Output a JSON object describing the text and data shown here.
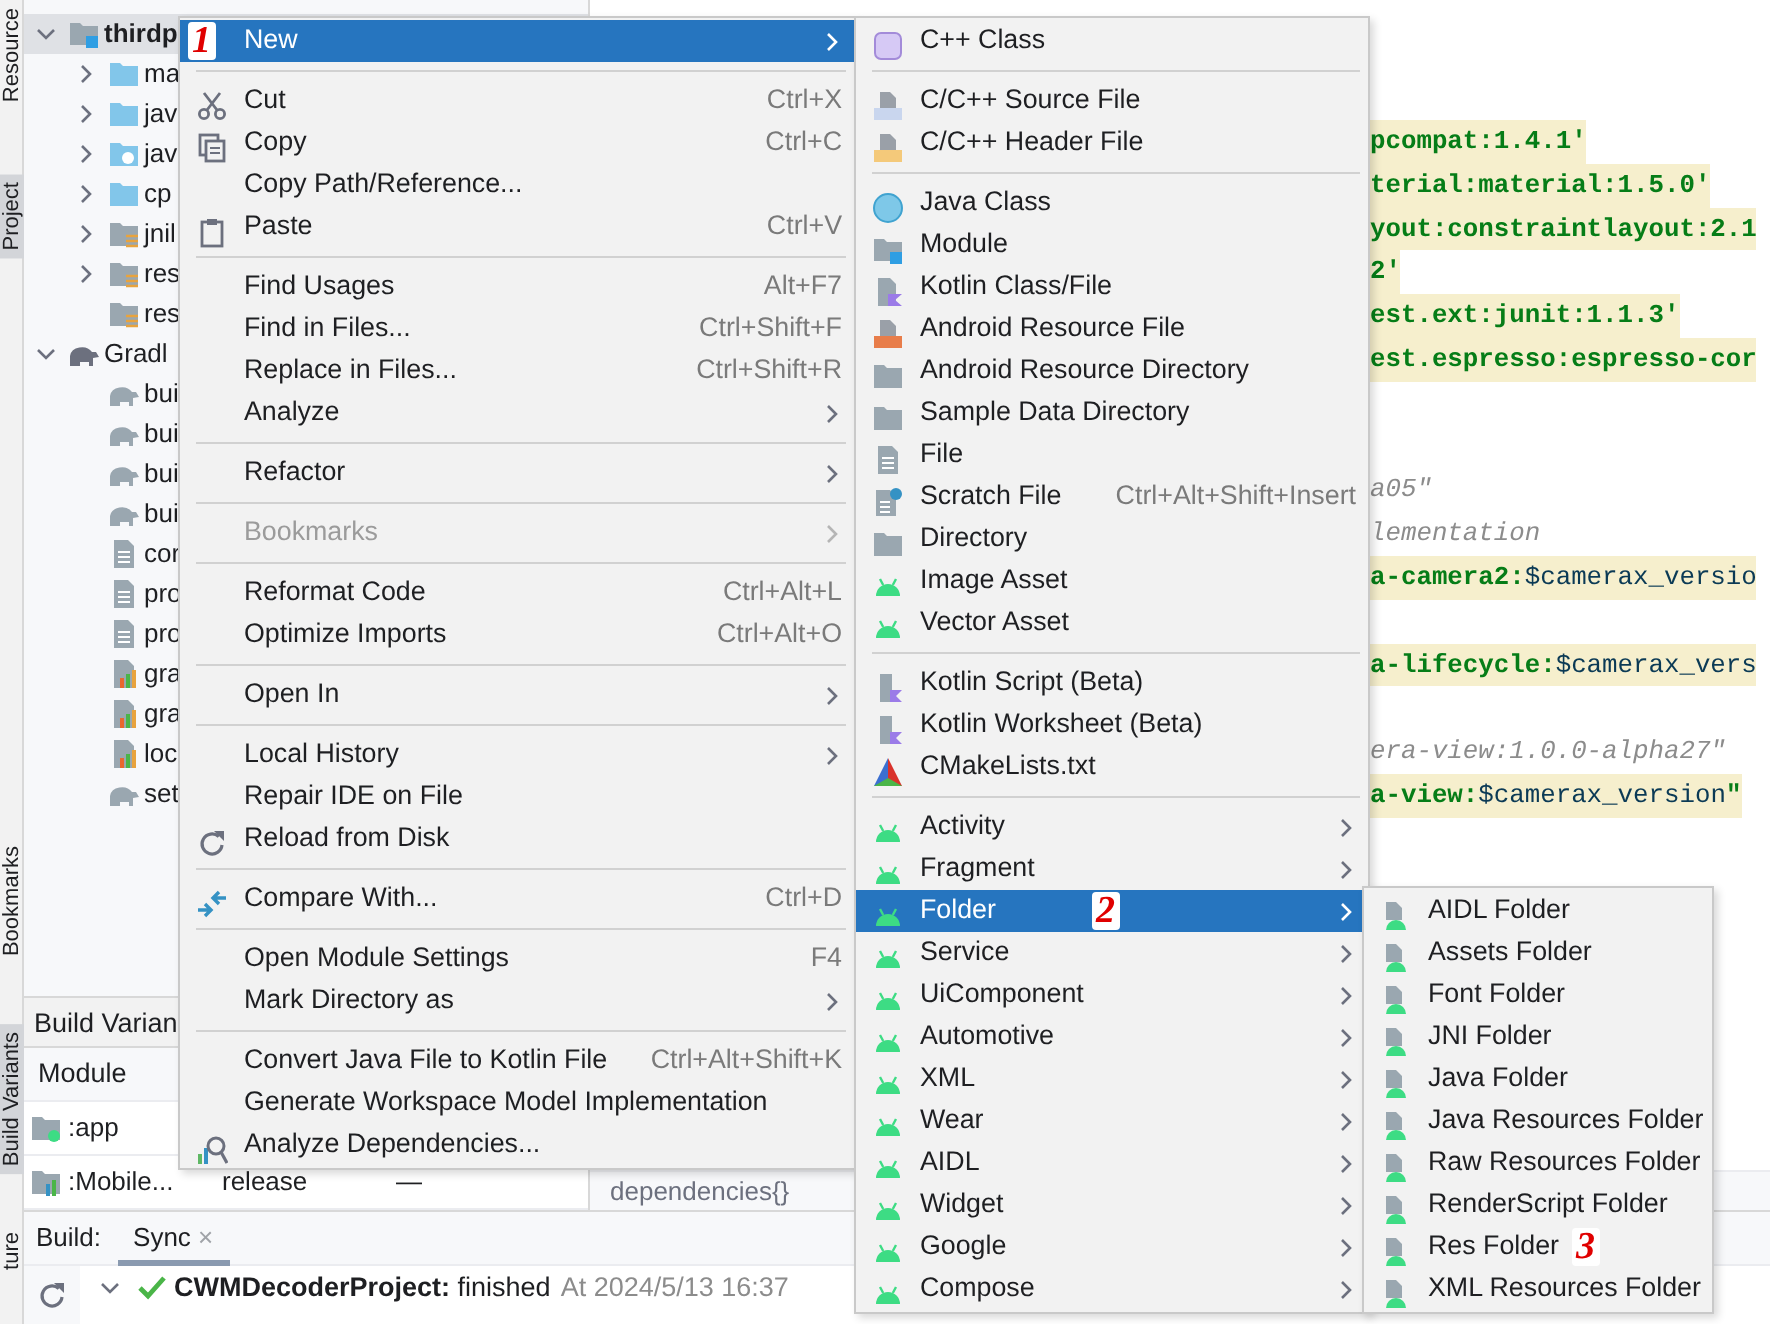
{
  "tool_strip": [
    {
      "label": "Resource",
      "selected": false
    },
    {
      "label": "Project",
      "selected": true
    },
    {
      "label": "Bookmarks",
      "selected": false
    },
    {
      "label": "Build Variants",
      "selected": true
    },
    {
      "label": "ture",
      "selected": false
    }
  ],
  "project_tree": [
    {
      "label": "thirdp",
      "kind": "module",
      "selected": true,
      "expanded": true,
      "children": [
        {
          "label": "ma",
          "kind": "bluefolder",
          "selected": false,
          "expanded": false
        },
        {
          "label": "jav",
          "kind": "bluefolder",
          "selected": false,
          "expanded": false
        },
        {
          "label": "jav",
          "kind": "gearfolder",
          "selected": false,
          "expanded": false
        },
        {
          "label": "cp",
          "kind": "bluefolder",
          "selected": false,
          "expanded": false
        },
        {
          "label": "jnil",
          "kind": "resfolder",
          "selected": false,
          "expanded": false
        },
        {
          "label": "res",
          "kind": "resfolder",
          "selected": false,
          "expanded": false
        },
        {
          "label": "res",
          "kind": "resfolder",
          "selected": false
        }
      ]
    },
    {
      "label": "Gradl",
      "kind": "gradle",
      "selected": false,
      "expanded": true,
      "children": [
        {
          "label": "bui",
          "kind": "gradlefile",
          "selected": false
        },
        {
          "label": "bui",
          "kind": "gradlefile",
          "selected": false
        },
        {
          "label": "bui",
          "kind": "gradlefile",
          "selected": false
        },
        {
          "label": "bui",
          "kind": "gradlefile",
          "selected": false
        },
        {
          "label": "cor",
          "kind": "file",
          "selected": false
        },
        {
          "label": "pro",
          "kind": "file",
          "selected": false
        },
        {
          "label": "pro",
          "kind": "file",
          "selected": false
        },
        {
          "label": "gra",
          "kind": "chartfile",
          "selected": false
        },
        {
          "label": "gra",
          "kind": "chartfile",
          "selected": false
        },
        {
          "label": "loc",
          "kind": "chartfile",
          "selected": false
        },
        {
          "label": "set",
          "kind": "gradlefile",
          "selected": false
        }
      ]
    }
  ],
  "build_variants": {
    "title": "Build Varian",
    "columns": [
      "Module"
    ],
    "rows": [
      {
        "module": ":app",
        "kind": "appfolder"
      },
      {
        "module": ":Mobile...",
        "kind": "chartfolder",
        "variant": "release",
        "column_3": "—"
      }
    ]
  },
  "editor": {
    "lines": [
      {
        "kind": "code",
        "segments": [
          {
            "kind": "string",
            "text": "pcompat:1.4.1'"
          }
        ]
      },
      {
        "kind": "code",
        "segments": [
          {
            "kind": "string",
            "text": "terial:material:1.5.0'"
          }
        ]
      },
      {
        "kind": "code",
        "segments": [
          {
            "kind": "string",
            "text": "yout:constraintlayout:2.1"
          }
        ]
      },
      {
        "kind": "code",
        "segments": [
          {
            "kind": "string",
            "text": "2'"
          }
        ]
      },
      {
        "kind": "code",
        "segments": [
          {
            "kind": "string",
            "text": "est.ext:junit:1.1.3'"
          }
        ]
      },
      {
        "kind": "code",
        "segments": [
          {
            "kind": "string",
            "text": "est.espresso:espresso-cor"
          }
        ]
      },
      {
        "kind": "blank"
      },
      {
        "kind": "blank"
      },
      {
        "kind": "comment",
        "segments": [
          {
            "kind": "comment",
            "text": "a05\""
          }
        ]
      },
      {
        "kind": "comment",
        "segments": [
          {
            "kind": "comment",
            "text": "lementation"
          }
        ]
      },
      {
        "kind": "code",
        "segments": [
          {
            "kind": "string",
            "text": "a-camera2:"
          },
          {
            "kind": "template",
            "text": "$camerax_versio"
          }
        ]
      },
      {
        "kind": "blank"
      },
      {
        "kind": "code",
        "segments": [
          {
            "kind": "string",
            "text": "a-lifecycle:"
          },
          {
            "kind": "template",
            "text": "$camerax_vers"
          }
        ]
      },
      {
        "kind": "blank"
      },
      {
        "kind": "comment",
        "segments": [
          {
            "kind": "comment",
            "text": "era-view:1.0.0-alpha27\""
          }
        ]
      },
      {
        "kind": "code",
        "segments": [
          {
            "kind": "string",
            "text": "a-view:"
          },
          {
            "kind": "template",
            "text": "$camerax_version"
          },
          {
            "kind": "string",
            "text": "\""
          }
        ]
      }
    ],
    "breadcrumb": "dependencies{}"
  },
  "build_window": {
    "label": "Build:",
    "tabs": [
      {
        "label": "Sync",
        "selected": true,
        "close": "×"
      }
    ],
    "result": {
      "text": "**CWMDecoderProject:** finished",
      "time": "At 2024/5/13 16:37",
      "expanded": true
    }
  },
  "main_menu": {
    "groups": [
      {
        "items": [
          {
            "label": "New",
            "submenu": true,
            "selected": true,
            "annotation": "1"
          }
        ]
      },
      {
        "items": [
          {
            "label": "Cut",
            "shortcut": "Ctrl+X",
            "kind": "scissors",
            "selected": false
          },
          {
            "label": "Copy",
            "shortcut": "Ctrl+C",
            "kind": "copy",
            "selected": false
          },
          {
            "label": "Copy Path/Reference...",
            "selected": false
          },
          {
            "label": "Paste",
            "shortcut": "Ctrl+V",
            "kind": "paste",
            "selected": false
          }
        ]
      },
      {
        "items": [
          {
            "label": "Find Usages",
            "shortcut": "Alt+F7",
            "selected": false
          },
          {
            "label": "Find in Files...",
            "shortcut": "Ctrl+Shift+F",
            "selected": false
          },
          {
            "label": "Replace in Files...",
            "shortcut": "Ctrl+Shift+R",
            "selected": false
          },
          {
            "label": "Analyze",
            "submenu": true,
            "selected": false
          }
        ]
      },
      {
        "items": [
          {
            "label": "Refactor",
            "submenu": true,
            "selected": false
          }
        ]
      },
      {
        "items": [
          {
            "label": "Bookmarks",
            "submenu": true,
            "selected": false,
            "disabled": true
          }
        ]
      },
      {
        "items": [
          {
            "label": "Reformat Code",
            "shortcut": "Ctrl+Alt+L",
            "selected": false
          },
          {
            "label": "Optimize Imports",
            "shortcut": "Ctrl+Alt+O",
            "selected": false
          }
        ]
      },
      {
        "items": [
          {
            "label": "Open In",
            "submenu": true,
            "selected": false
          }
        ]
      },
      {
        "items": [
          {
            "label": "Local History",
            "submenu": true,
            "selected": false
          },
          {
            "label": "Repair IDE on File",
            "selected": false
          },
          {
            "label": "Reload from Disk",
            "kind": "reload",
            "selected": false
          }
        ]
      },
      {
        "items": [
          {
            "label": "Compare With...",
            "shortcut": "Ctrl+D",
            "kind": "compare",
            "selected": false
          }
        ]
      },
      {
        "items": [
          {
            "label": "Open Module Settings",
            "shortcut": "F4",
            "selected": false
          },
          {
            "label": "Mark Directory as",
            "submenu": true,
            "selected": false
          }
        ]
      },
      {
        "items": [
          {
            "label": "Convert Java File to Kotlin File",
            "shortcut": "Ctrl+Alt+Shift+K",
            "selected": false
          },
          {
            "label": "Generate Workspace Model Implementation",
            "selected": false
          },
          {
            "label": "Analyze Dependencies...",
            "kind": "deps",
            "selected": false
          }
        ]
      }
    ]
  },
  "new_submenu": {
    "groups": [
      {
        "items": [
          {
            "label": "C++ Class",
            "kind": "cppclass",
            "selected": false
          }
        ]
      },
      {
        "items": [
          {
            "label": "C/C++ Source File",
            "kind": "srcfile",
            "selected": false
          },
          {
            "label": "C/C++ Header File",
            "kind": "header",
            "selected": false
          }
        ]
      },
      {
        "items": [
          {
            "label": "Java Class",
            "kind": "javaclass",
            "selected": false
          },
          {
            "label": "Module",
            "kind": "module",
            "selected": false
          },
          {
            "label": "Kotlin Class/File",
            "kind": "kotlin",
            "selected": false
          },
          {
            "label": "Android Resource File",
            "kind": "resfile",
            "selected": false
          },
          {
            "label": "Android Resource Directory",
            "kind": "folder",
            "selected": false
          },
          {
            "label": "Sample Data Directory",
            "kind": "folder",
            "selected": false
          },
          {
            "label": "File",
            "kind": "file",
            "selected": false
          },
          {
            "label": "Scratch File",
            "shortcut": "Ctrl+Alt+Shift+Insert",
            "kind": "scratch",
            "selected": false
          },
          {
            "label": "Directory",
            "kind": "folder",
            "selected": false
          },
          {
            "label": "Image Asset",
            "kind": "android",
            "selected": false
          },
          {
            "label": "Vector Asset",
            "kind": "android",
            "selected": false
          }
        ]
      },
      {
        "items": [
          {
            "label": "Kotlin Script (Beta)",
            "kind": "kscript",
            "selected": false
          },
          {
            "label": "Kotlin Worksheet (Beta)",
            "kind": "kscript",
            "selected": false
          },
          {
            "label": "CMakeLists.txt",
            "kind": "cmake",
            "selected": false
          }
        ]
      },
      {
        "items": [
          {
            "label": "Activity",
            "kind": "android",
            "submenu": true,
            "selected": false
          },
          {
            "label": "Fragment",
            "kind": "android",
            "submenu": true,
            "selected": false
          },
          {
            "label": "Folder",
            "kind": "android",
            "submenu": true,
            "selected": true,
            "annotation": "2"
          },
          {
            "label": "Service",
            "kind": "android",
            "submenu": true,
            "selected": false
          },
          {
            "label": "UiComponent",
            "kind": "android",
            "submenu": true,
            "selected": false
          },
          {
            "label": "Automotive",
            "kind": "android",
            "submenu": true,
            "selected": false
          },
          {
            "label": "XML",
            "kind": "android",
            "submenu": true,
            "selected": false
          },
          {
            "label": "Wear",
            "kind": "android",
            "submenu": true,
            "selected": false
          },
          {
            "label": "AIDL",
            "kind": "android",
            "submenu": true,
            "selected": false
          },
          {
            "label": "Widget",
            "kind": "android",
            "submenu": true,
            "selected": false
          },
          {
            "label": "Google",
            "kind": "android",
            "submenu": true,
            "selected": false
          },
          {
            "label": "Compose",
            "kind": "android",
            "submenu": true,
            "selected": false
          }
        ]
      }
    ]
  },
  "folder_submenu": {
    "groups": [
      {
        "items": [
          {
            "label": "AIDL Folder",
            "kind": "afolder",
            "selected": false
          },
          {
            "label": "Assets Folder",
            "kind": "afolder",
            "selected": false
          },
          {
            "label": "Font Folder",
            "kind": "afolder",
            "selected": false
          },
          {
            "label": "JNI Folder",
            "kind": "afolder",
            "selected": false
          },
          {
            "label": "Java Folder",
            "kind": "afolder",
            "selected": false
          },
          {
            "label": "Java Resources Folder",
            "kind": "afolder",
            "selected": false
          },
          {
            "label": "Raw Resources Folder",
            "kind": "afolder",
            "selected": false
          },
          {
            "label": "RenderScript Folder",
            "kind": "afolder",
            "selected": false
          },
          {
            "label": "Res Folder",
            "kind": "afolder",
            "selected": false,
            "annotation": "3"
          },
          {
            "label": "XML Resources Folder",
            "kind": "afolder",
            "selected": false
          }
        ]
      }
    ]
  }
}
